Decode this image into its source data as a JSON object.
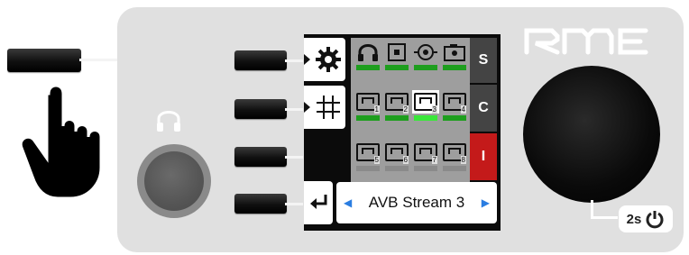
{
  "device": {
    "brand_logo": "RME",
    "colors": {
      "panel": "#e0e0e0",
      "level_green": "#1e9e1e",
      "level_bright": "#3ae63a",
      "alert_red": "#c41a1a"
    }
  },
  "screen": {
    "menu_icons": [
      "gear-icon",
      "grid-icon",
      "",
      "return-icon"
    ],
    "top_icons": [
      "headphones-icon",
      "box-icon",
      "target-icon",
      "camera-icon"
    ],
    "streams_row1": [
      "1",
      "2",
      "3",
      "4"
    ],
    "streams_row2": [
      "5",
      "6",
      "7",
      "8"
    ],
    "side_buttons": {
      "s": "S",
      "c": "C",
      "i": "I"
    },
    "selected_stream": "AVB Stream 3",
    "prev_arrow": "◀",
    "next_arrow": "▶"
  },
  "power_badge": {
    "label": "2s"
  }
}
